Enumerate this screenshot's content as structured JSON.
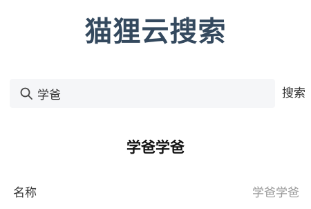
{
  "header": {
    "app_title": "猫狸云搜索"
  },
  "search": {
    "query": "学爸",
    "button_label": "搜索"
  },
  "result": {
    "title": "学爸学爸",
    "fields": [
      {
        "label": "名称",
        "value": "学爸学爸"
      }
    ]
  },
  "colors": {
    "title": "#34495e",
    "search_bg": "#f5f6f8",
    "muted_text": "#9a9a9a"
  },
  "icons": {
    "search": "search-icon"
  }
}
